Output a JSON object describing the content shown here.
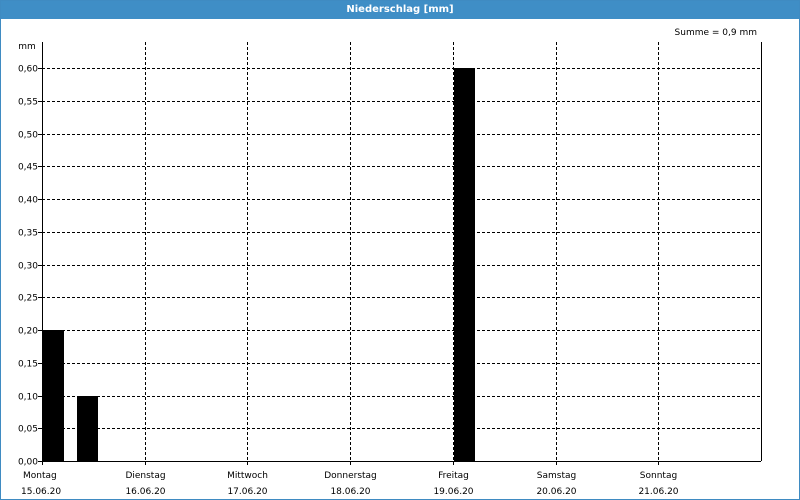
{
  "window": {
    "title": "Niederschlag [mm]"
  },
  "summary": "Summe = 0,9 mm",
  "chart_data": {
    "type": "bar",
    "title": "Niederschlag [mm]",
    "ylabel": "mm",
    "xlabel": "",
    "ylim": [
      0,
      0.64
    ],
    "ytick_values": [
      0,
      0.05,
      0.1,
      0.15,
      0.2,
      0.25,
      0.3,
      0.35,
      0.4,
      0.45,
      0.5,
      0.55,
      0.6
    ],
    "ytick_labels": [
      "0,00",
      "0,05",
      "0,10",
      "0,15",
      "0,20",
      "0,25",
      "0,30",
      "0,35",
      "0,40",
      "0,45",
      "0,50",
      "0,55",
      "0,60"
    ],
    "x_range": [
      "2020-06-15T00:00",
      "2020-06-22T00:00"
    ],
    "day_ticks": [
      {
        "day": "Montag",
        "date": "15.06.20"
      },
      {
        "day": "Dienstag",
        "date": "16.06.20"
      },
      {
        "day": "Mittwoch",
        "date": "17.06.20"
      },
      {
        "day": "Donnerstag",
        "date": "18.06.20"
      },
      {
        "day": "Freitag",
        "date": "19.06.20"
      },
      {
        "day": "Samstag",
        "date": "20.06.20"
      },
      {
        "day": "Sonntag",
        "date": "21.06.20"
      }
    ],
    "grid": true,
    "bar_width_hours": 5,
    "series": [
      {
        "color": "#000000",
        "points": [
          {
            "x": "2020-06-15T00:00",
            "y": 0.2
          },
          {
            "x": "2020-06-15T08:00",
            "y": 0.1
          },
          {
            "x": "2020-06-19T00:00",
            "y": 0.6
          }
        ]
      }
    ]
  }
}
